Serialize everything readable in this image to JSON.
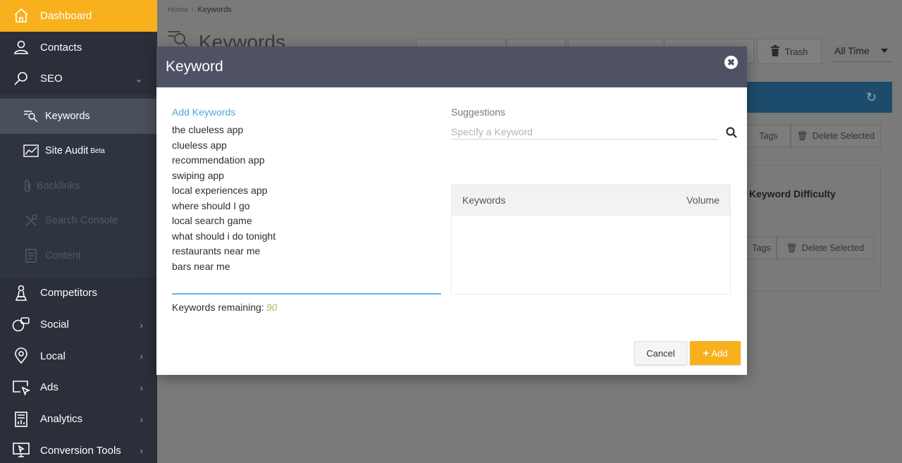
{
  "sidebar": {
    "items": [
      {
        "label": "Dashboard",
        "icon": "home-icon"
      },
      {
        "label": "Contacts",
        "icon": "user-icon"
      },
      {
        "label": "SEO",
        "icon": "magnifier-icon"
      },
      {
        "label": "Competitors",
        "icon": "chess-pawn-icon"
      },
      {
        "label": "Social",
        "icon": "chat-icon"
      },
      {
        "label": "Local",
        "icon": "map-pin-icon"
      },
      {
        "label": "Ads",
        "icon": "cursor-window-icon"
      },
      {
        "label": "Analytics",
        "icon": "report-icon"
      },
      {
        "label": "Conversion Tools",
        "icon": "monitor-cursor-icon"
      }
    ],
    "seo_sub": [
      {
        "label": "Keywords",
        "icon": "keywords-icon"
      },
      {
        "label": "Site Audit",
        "badge": "Beta",
        "icon": "chart-trend-icon"
      },
      {
        "label": "Backlinks",
        "icon": "paperclip-icon"
      },
      {
        "label": "Search Console",
        "icon": "tools-icon"
      },
      {
        "label": "Content",
        "icon": "document-icon"
      }
    ]
  },
  "breadcrumb": {
    "home": "Home",
    "separator": "/",
    "current": "Keywords"
  },
  "page": {
    "title": "Keywords"
  },
  "toolbar": {
    "trash_label": "Trash",
    "time_filter": "All Time"
  },
  "background": {
    "tags_label": "Tags",
    "delete_selected_label": "Delete Selected",
    "keyword_difficulty": "Keyword Difficulty"
  },
  "modal": {
    "title": "Keyword",
    "close_symbol": "✖",
    "add_keywords_label": "Add Keywords",
    "keywords": [
      "the clueless app",
      "clueless app",
      "recommendation app",
      "swiping app",
      "local experiences app",
      "where should I go",
      "local search game",
      "what should i do tonight",
      "restaurants near me",
      "bars near me"
    ],
    "remaining_label": "Keywords remaining:",
    "remaining_count": "90",
    "suggestions_label": "Suggestions",
    "suggestions_placeholder": "Specify a Keyword",
    "table_col_keywords": "Keywords",
    "table_col_volume": "Volume",
    "cancel_label": "Cancel",
    "add_label": "Add"
  },
  "colors": {
    "accent": "#f8b01d",
    "sidebar_bg": "#2a2f3a",
    "modal_header": "#4e5264",
    "link_blue": "#4aa9de",
    "remaining_green": "#9ec44a"
  }
}
